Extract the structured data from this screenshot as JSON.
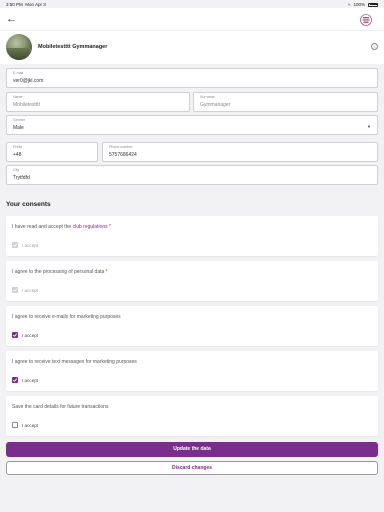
{
  "status_bar": {
    "time": "3:50 PM",
    "date": "Mon Apr 3",
    "battery": "100%"
  },
  "header": {
    "back_icon": "arrow-left-icon",
    "logo_icon": "app-logo-icon"
  },
  "profile": {
    "name": "Mobiletestttt Gymmanager"
  },
  "form": {
    "email": {
      "label": "E-mail",
      "value": "ver0@jkl.com"
    },
    "name": {
      "label": "Name",
      "value": "Mobiletestttt"
    },
    "surname": {
      "label": "Surname",
      "value": "Gymmanager"
    },
    "gender": {
      "label": "Gender",
      "value": "Male"
    },
    "prefix": {
      "label": "Prefix",
      "value": "+48"
    },
    "phone": {
      "label": "Phone number",
      "value": "5757686424"
    },
    "city": {
      "label": "City",
      "value": "Trytfdfd"
    }
  },
  "consents": {
    "title": "Your consents",
    "items": [
      {
        "text_before": "I have read and accept the ",
        "link": "club regulations",
        "required": "*",
        "checkbox_label": "I accept",
        "state": "disabled-checked"
      },
      {
        "text_before": "I agree to the processing of personal data ",
        "link": "",
        "required": "*",
        "checkbox_label": "I accept",
        "state": "disabled-checked"
      },
      {
        "text_before": "I agree to receive e-mails for marketing purposes",
        "link": "",
        "required": "",
        "checkbox_label": "I accept",
        "state": "checked"
      },
      {
        "text_before": "I agree to receive text messages for marketing purposes",
        "link": "",
        "required": "",
        "checkbox_label": "I accept",
        "state": "checked"
      },
      {
        "text_before": "Save the card details for future transactions",
        "link": "",
        "required": "",
        "checkbox_label": "I accept",
        "state": "unchecked"
      }
    ]
  },
  "actions": {
    "primary": "Update the data",
    "secondary": "Discard changes"
  },
  "colors": {
    "accent": "#7b2d8e",
    "background": "#f2f2f4"
  }
}
